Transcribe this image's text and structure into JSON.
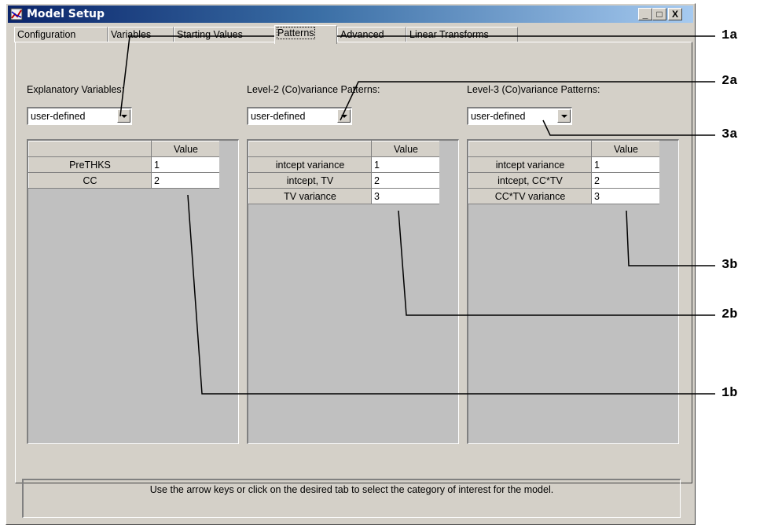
{
  "window": {
    "title": "Model Setup",
    "controls": {
      "minimize": "_",
      "maximize": "□",
      "close": "X"
    }
  },
  "tabs": [
    {
      "label": "Configuration",
      "active": false
    },
    {
      "label": "Variables",
      "active": false
    },
    {
      "label": "Starting Values",
      "active": false
    },
    {
      "label": "Patterns",
      "active": true
    },
    {
      "label": "Advanced",
      "active": false
    },
    {
      "label": "Linear Transforms",
      "active": false
    }
  ],
  "sections": {
    "explanatory": {
      "label": "Explanatory Variables:",
      "selected": "user-defined",
      "value_header": "Value",
      "rows": [
        {
          "name": "PreTHKS",
          "value": "1"
        },
        {
          "name": "CC",
          "value": "2"
        }
      ]
    },
    "level2": {
      "label": "Level-2 (Co)variance Patterns:",
      "selected": "user-defined",
      "value_header": "Value",
      "rows": [
        {
          "name": "intcept variance",
          "value": "1"
        },
        {
          "name": "intcept, TV",
          "value": "2"
        },
        {
          "name": "TV variance",
          "value": "3"
        }
      ]
    },
    "level3": {
      "label": "Level-3 (Co)variance Patterns:",
      "selected": "user-defined",
      "value_header": "Value",
      "rows": [
        {
          "name": "intcept variance",
          "value": "1"
        },
        {
          "name": "intcept, CC*TV",
          "value": "2"
        },
        {
          "name": "CC*TV variance",
          "value": "3"
        }
      ]
    }
  },
  "status_text": "Use the arrow keys or click on the desired tab to select the category of interest for the model.",
  "callouts": {
    "c1a": "1a",
    "c2a": "2a",
    "c3a": "3a",
    "c3b": "3b",
    "c2b": "2b",
    "c1b": "1b"
  }
}
